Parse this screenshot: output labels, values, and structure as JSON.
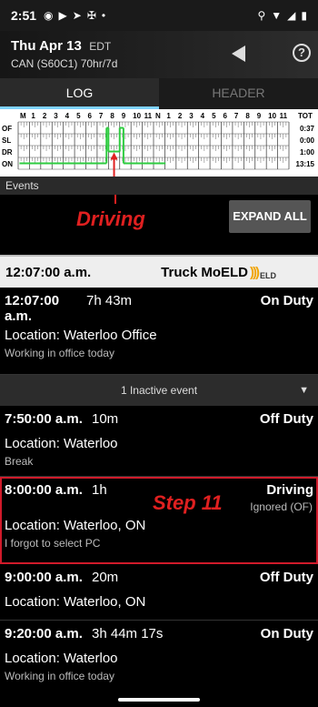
{
  "status": {
    "time": "2:51"
  },
  "header": {
    "date": "Thu Apr 13",
    "tz": "EDT",
    "cycle": "CAN (S60C1) 70hr/7d"
  },
  "tabs": [
    {
      "label": "LOG"
    },
    {
      "label": "HEADER"
    }
  ],
  "log_grid": {
    "hours": [
      "M",
      "1",
      "2",
      "3",
      "4",
      "5",
      "6",
      "7",
      "8",
      "9",
      "10",
      "11",
      "N",
      "1",
      "2",
      "3",
      "4",
      "5",
      "6",
      "7",
      "8",
      "9",
      "10",
      "11"
    ],
    "rows": [
      "OF",
      "SL",
      "DR",
      "ON"
    ],
    "tot_header": "TOT",
    "totals": [
      "0:37",
      "0:00",
      "1:00",
      "13:15"
    ]
  },
  "events_label": "Events",
  "annotations": {
    "driving": "Driving",
    "step": "Step 11"
  },
  "expand_all": "EXPAND ALL",
  "truck": {
    "time": "12:07:00 a.m.",
    "brand": "Truck MoELD",
    "eld": "ELD"
  },
  "events": [
    {
      "time": "12:07:00 a.m.",
      "duration": "7h 43m",
      "status": "On Duty",
      "location": "Location:  Waterloo Office",
      "note": "Working in office today"
    },
    {
      "time": "7:50:00 a.m.",
      "duration": "10m",
      "status": "Off Duty",
      "location": "Location:  Waterloo",
      "note": "Break"
    },
    {
      "time": "8:00:00 a.m.",
      "duration": "1h",
      "status": "Driving",
      "sub_status": "Ignored (OF)",
      "location": "Location:  Waterloo, ON",
      "note": "I forgot to select PC"
    },
    {
      "time": "9:00:00 a.m.",
      "duration": "20m",
      "status": "Off Duty",
      "location": "Location:  Waterloo, ON",
      "note": ""
    },
    {
      "time": "9:20:00 a.m.",
      "duration": "3h 44m 17s",
      "status": "On Duty",
      "location": "Location:  Waterloo",
      "note": "Working in office today"
    }
  ],
  "inactive": "1 Inactive event",
  "colors": {
    "accent": "#7fd3ff",
    "status_line": "#2ecc40",
    "annotation": "#e02020"
  }
}
